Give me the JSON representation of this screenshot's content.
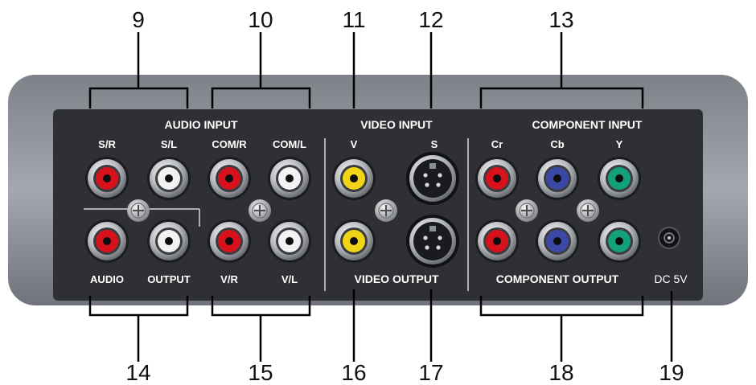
{
  "callouts": {
    "n9": "9",
    "n10": "10",
    "n11": "11",
    "n12": "12",
    "n13": "13",
    "n14": "14",
    "n15": "15",
    "n16": "16",
    "n17": "17",
    "n18": "18",
    "n19": "19"
  },
  "sections": {
    "audio_input": "AUDIO INPUT",
    "video_input": "VIDEO INPUT",
    "component_input": "COMPONENT INPUT",
    "video_output": "VIDEO OUTPUT",
    "component_output": "COMPONENT OUTPUT"
  },
  "port_labels": {
    "s_r": "S/R",
    "s_l": "S/L",
    "com_r": "COM/R",
    "com_l": "COM/L",
    "v": "V",
    "s": "S",
    "cr": "Cr",
    "cb": "Cb",
    "y": "Y",
    "audio": "AUDIO",
    "output": "OUTPUT",
    "v_r": "V/R",
    "v_l": "V/L",
    "dc_5v": "DC 5V"
  },
  "colors": {
    "red": "#d8121c",
    "white": "#f2f2f2",
    "yellow": "#f1d415",
    "blue": "#3b49a6",
    "green": "#13a07a",
    "panel": "#2e3034",
    "chassis": "#8f949b"
  }
}
